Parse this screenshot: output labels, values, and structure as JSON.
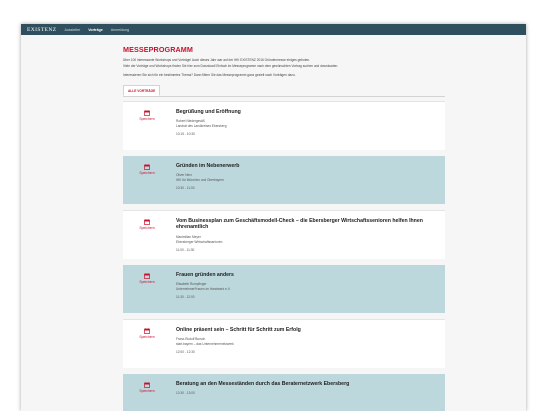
{
  "header": {
    "brand": "EXISTENZ",
    "nav": [
      "Aussteller",
      "Vorträge",
      "Anmeldung"
    ]
  },
  "page": {
    "title": "MESSEPROGRAMM",
    "intro": [
      "Über 100 interessante Workshops und Vorträge! Auch dieses Jahr war auf der IHK EXISTENZ 2016 Gründermesse einiges geboten.",
      "Viele der Vorträge und Workshops finden Sie hier zum Download! Einfach im Messeprogramm nach dem gewünschten Vortrag suchen und downloaden.",
      "Interessieren Sie sich für ein bestimmtes Thema? Dann filtern Sie das Messeprogramm ganz gezielt nach Vorträgen dazu."
    ],
    "tab_label": "ALLE VORTRÄGE",
    "save_label": "Speichern"
  },
  "program": [
    {
      "title": "Begrüßung und Eröffnung",
      "speaker": "Robert Niedergesäß",
      "org": "Landrat des Landkreises Ebersberg",
      "time": "10:15 - 10:30"
    },
    {
      "title": "Gründen im Nebenerwerb",
      "speaker": "Oliver Nerz",
      "org": "IHK für München und Oberbayern",
      "time": "10:30 - 11:00"
    },
    {
      "title": "Vom Businessplan zum Geschäftsmodell-Check – die Ebersberger Wirtschaftssenioren helfen Ihnen ehrenamtlich",
      "speaker": "Maximilian Meyer",
      "org": "Ebersberger Wirtschaftssenioren",
      "time": "11:00 - 11:30"
    },
    {
      "title": "Frauen gründen anders",
      "speaker": "Elisabeth Rumpfinger",
      "org": "UnternehmerFrauen im Handwerk e.V.",
      "time": "11:30 - 12:00"
    },
    {
      "title": "Online präsent sein – Schritt für Schritt zum Erfolg",
      "speaker": "Franz-Rudolf Bursch",
      "org": "start.bayern – das Unternehmernetzwerk",
      "time": "12:00 - 12:30"
    },
    {
      "title": "Beratung an den Messeständen durch das Beraternetzwerk Ebersberg",
      "speaker": "",
      "org": "",
      "time": "12:30 - 13:00"
    }
  ],
  "colors": {
    "accent": "#c8102e",
    "topbar": "#2f4f5e",
    "row_alt": "#bcd8dc"
  }
}
